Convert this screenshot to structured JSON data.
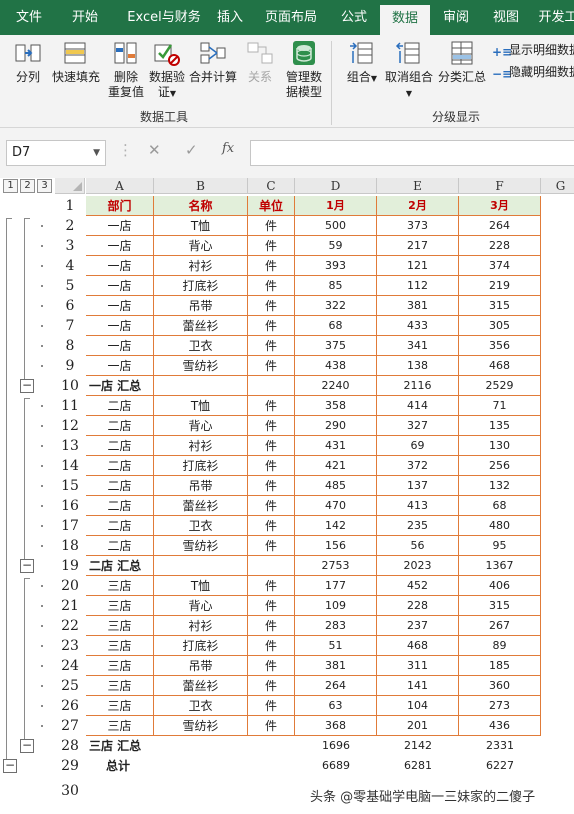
{
  "ribbon": {
    "tabs": [
      "文件",
      "开始",
      "Excel与财务",
      "插入",
      "页面布局",
      "公式",
      "数据",
      "审阅",
      "视图",
      "开发工"
    ],
    "active_tab": "数据",
    "data_tools": {
      "split": "分列",
      "flash_fill": "快速填充",
      "remove_dup_1": "删除",
      "remove_dup_2": "重复值",
      "validation_1": "数据验",
      "validation_2": "证",
      "consolidate": "合并计算",
      "relations": "关系",
      "model_1": "管理数",
      "model_2": "据模型",
      "group_label": "数据工具"
    },
    "outline": {
      "group": "组合",
      "ungroup": "取消组合",
      "subtotal": "分类汇总",
      "show_detail": "显示明细数据",
      "hide_detail": "隐藏明细数据",
      "group_label": "分级显示"
    }
  },
  "formula_bar": {
    "name_box": "D7",
    "fx": "fx",
    "formula": ""
  },
  "sheet": {
    "outline_levels": [
      "1",
      "2",
      "3"
    ],
    "columns": [
      "A",
      "B",
      "C",
      "D",
      "E",
      "F",
      "G"
    ],
    "rows": [
      {
        "n": "1",
        "cells": [
          "部门",
          "名称",
          "单位",
          "1月",
          "2月",
          "3月"
        ],
        "type": "header"
      },
      {
        "n": "2",
        "cells": [
          "一店",
          "T恤",
          "件",
          "500",
          "373",
          "264"
        ],
        "type": "data"
      },
      {
        "n": "3",
        "cells": [
          "一店",
          "背心",
          "件",
          "59",
          "217",
          "228"
        ],
        "type": "data"
      },
      {
        "n": "4",
        "cells": [
          "一店",
          "衬衫",
          "件",
          "393",
          "121",
          "374"
        ],
        "type": "data"
      },
      {
        "n": "5",
        "cells": [
          "一店",
          "打底衫",
          "件",
          "85",
          "112",
          "219"
        ],
        "type": "data"
      },
      {
        "n": "6",
        "cells": [
          "一店",
          "吊带",
          "件",
          "322",
          "381",
          "315"
        ],
        "type": "data"
      },
      {
        "n": "7",
        "cells": [
          "一店",
          "蕾丝衫",
          "件",
          "68",
          "433",
          "305"
        ],
        "type": "data"
      },
      {
        "n": "8",
        "cells": [
          "一店",
          "卫衣",
          "件",
          "375",
          "341",
          "356"
        ],
        "type": "data"
      },
      {
        "n": "9",
        "cells": [
          "一店",
          "雪纺衫",
          "件",
          "438",
          "138",
          "468"
        ],
        "type": "data"
      },
      {
        "n": "10",
        "cells": [
          "一店 汇总",
          "",
          "",
          "2240",
          "2116",
          "2529"
        ],
        "type": "subtotal"
      },
      {
        "n": "11",
        "cells": [
          "二店",
          "T恤",
          "件",
          "358",
          "414",
          "71"
        ],
        "type": "data"
      },
      {
        "n": "12",
        "cells": [
          "二店",
          "背心",
          "件",
          "290",
          "327",
          "135"
        ],
        "type": "data"
      },
      {
        "n": "13",
        "cells": [
          "二店",
          "衬衫",
          "件",
          "431",
          "69",
          "130"
        ],
        "type": "data"
      },
      {
        "n": "14",
        "cells": [
          "二店",
          "打底衫",
          "件",
          "421",
          "372",
          "256"
        ],
        "type": "data"
      },
      {
        "n": "15",
        "cells": [
          "二店",
          "吊带",
          "件",
          "485",
          "137",
          "132"
        ],
        "type": "data"
      },
      {
        "n": "16",
        "cells": [
          "二店",
          "蕾丝衫",
          "件",
          "470",
          "413",
          "68"
        ],
        "type": "data"
      },
      {
        "n": "17",
        "cells": [
          "二店",
          "卫衣",
          "件",
          "142",
          "235",
          "480"
        ],
        "type": "data"
      },
      {
        "n": "18",
        "cells": [
          "二店",
          "雪纺衫",
          "件",
          "156",
          "56",
          "95"
        ],
        "type": "data"
      },
      {
        "n": "19",
        "cells": [
          "二店 汇总",
          "",
          "",
          "2753",
          "2023",
          "1367"
        ],
        "type": "subtotal"
      },
      {
        "n": "20",
        "cells": [
          "三店",
          "T恤",
          "件",
          "177",
          "452",
          "406"
        ],
        "type": "data"
      },
      {
        "n": "21",
        "cells": [
          "三店",
          "背心",
          "件",
          "109",
          "228",
          "315"
        ],
        "type": "data"
      },
      {
        "n": "22",
        "cells": [
          "三店",
          "衬衫",
          "件",
          "283",
          "237",
          "267"
        ],
        "type": "data"
      },
      {
        "n": "23",
        "cells": [
          "三店",
          "打底衫",
          "件",
          "51",
          "468",
          "89"
        ],
        "type": "data"
      },
      {
        "n": "24",
        "cells": [
          "三店",
          "吊带",
          "件",
          "381",
          "311",
          "185"
        ],
        "type": "data"
      },
      {
        "n": "25",
        "cells": [
          "三店",
          "蕾丝衫",
          "件",
          "264",
          "141",
          "360"
        ],
        "type": "data"
      },
      {
        "n": "26",
        "cells": [
          "三店",
          "卫衣",
          "件",
          "63",
          "104",
          "273"
        ],
        "type": "data"
      },
      {
        "n": "27",
        "cells": [
          "三店",
          "雪纺衫",
          "件",
          "368",
          "201",
          "436"
        ],
        "type": "data"
      },
      {
        "n": "28",
        "cells": [
          "三店 汇总",
          "",
          "",
          "1696",
          "2142",
          "2331"
        ],
        "type": "subtotal_noborder"
      },
      {
        "n": "29",
        "cells": [
          "总计",
          "",
          "",
          "6689",
          "6281",
          "6227"
        ],
        "type": "total"
      },
      {
        "n": "30",
        "cells": [
          "",
          "",
          "",
          "",
          "",
          ""
        ],
        "type": "empty"
      }
    ]
  },
  "watermark": "头条 @零基础学电脑一三妹家的二傻子",
  "colors": {
    "ribbon_green": "#217346",
    "header_fill": "#e2efda",
    "header_text": "#c00000",
    "cell_border": "#e07b39"
  }
}
